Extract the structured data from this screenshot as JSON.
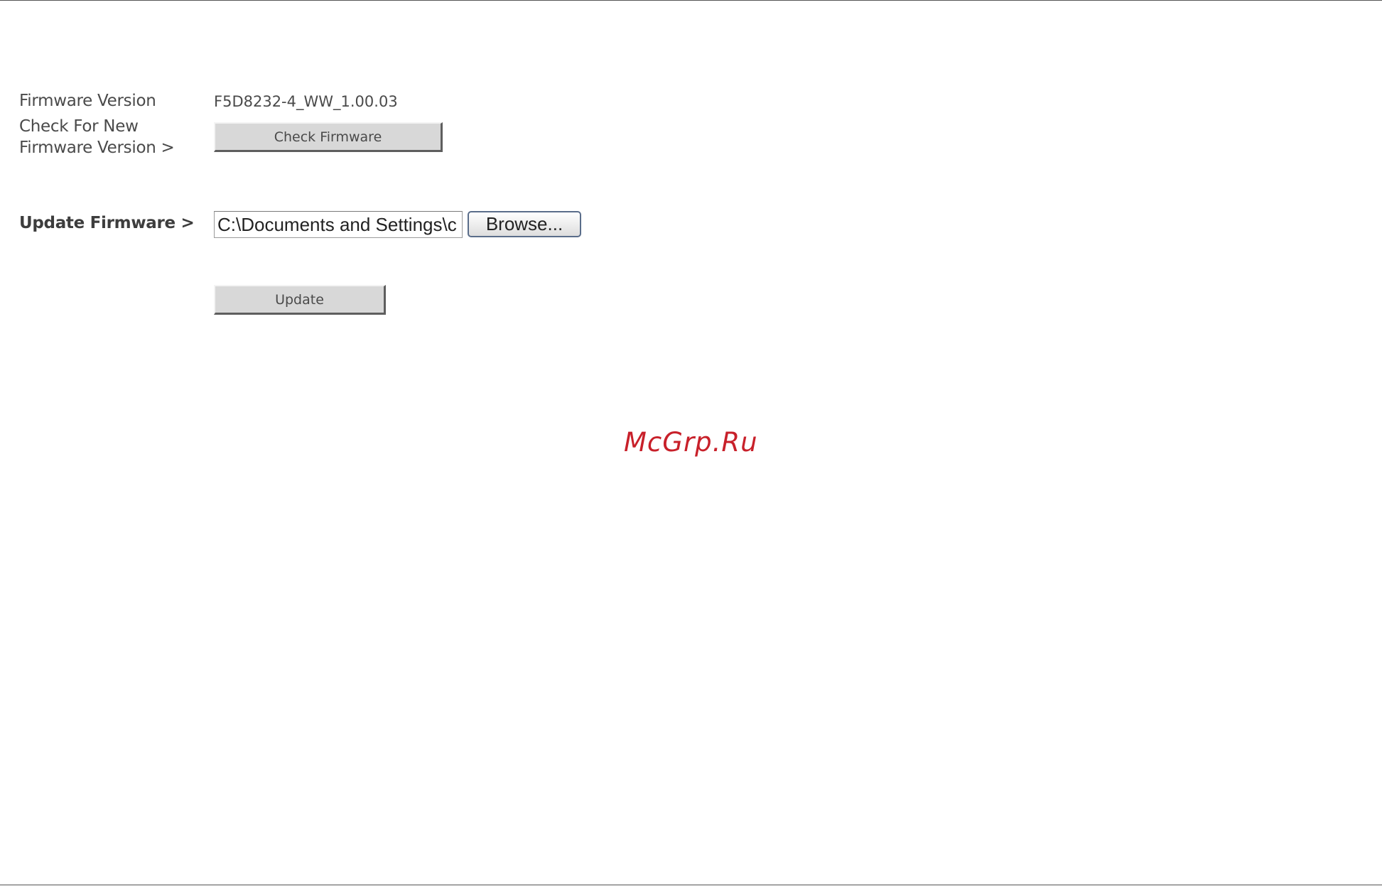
{
  "firmware": {
    "version_label": "Firmware Version",
    "version_value": "F5D8232-4_WW_1.00.03",
    "check_label_line1": "Check For New",
    "check_label_line2": "Firmware Version >",
    "check_button": "Check Firmware",
    "update_label": "Update Firmware >",
    "file_path_value": "C:\\Documents and Settings\\c",
    "browse_button": "Browse...",
    "update_button": "Update"
  },
  "watermark": {
    "text": "McGrp.Ru",
    "color": "#c8202a"
  }
}
